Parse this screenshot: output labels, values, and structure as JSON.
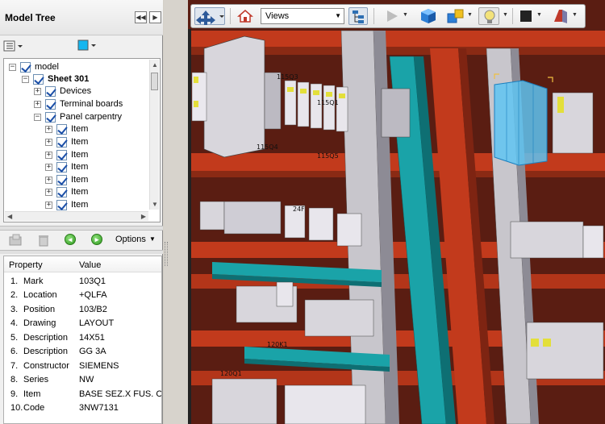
{
  "panel": {
    "title": "Model Tree",
    "options_label": "Options"
  },
  "tree": {
    "root": "model",
    "sheet": "Sheet 301",
    "groups": [
      "Devices",
      "Terminal boards",
      "Panel carpentry"
    ],
    "items": [
      "Item",
      "Item",
      "Item",
      "Item",
      "Item",
      "Item",
      "Item"
    ]
  },
  "properties": {
    "header_property": "Property",
    "header_value": "Value",
    "rows": [
      {
        "num": "1.",
        "name": "Mark",
        "value": "103Q1"
      },
      {
        "num": "2.",
        "name": "Location",
        "value": "+QLFA"
      },
      {
        "num": "3.",
        "name": "Position",
        "value": "103/B2"
      },
      {
        "num": "4.",
        "name": "Drawing",
        "value": "LAYOUT"
      },
      {
        "num": "5.",
        "name": "Description",
        "value": "14X51"
      },
      {
        "num": "6.",
        "name": "Description",
        "value": "GG 3A"
      },
      {
        "num": "7.",
        "name": "Constructor",
        "value": "SIEMENS"
      },
      {
        "num": "8.",
        "name": "Series",
        "value": "NW"
      },
      {
        "num": "9.",
        "name": "Item",
        "value": "BASE SEZ.X FUS. CILIN"
      },
      {
        "num": "10.",
        "name": "Code",
        "value": "3NW7131"
      }
    ]
  },
  "toolbar": {
    "views_value": "Views"
  },
  "scene": {
    "labels": [
      "115Q3",
      "115Q4",
      "115Q5",
      "120K1",
      "120Q1",
      "24F",
      "115Q1"
    ]
  },
  "colors": {
    "panel_red": "#c23a1c",
    "rail_teal": "#1aa3a8",
    "device_gray": "#c9c5cf",
    "selected_blue": "#5fc4f2"
  }
}
